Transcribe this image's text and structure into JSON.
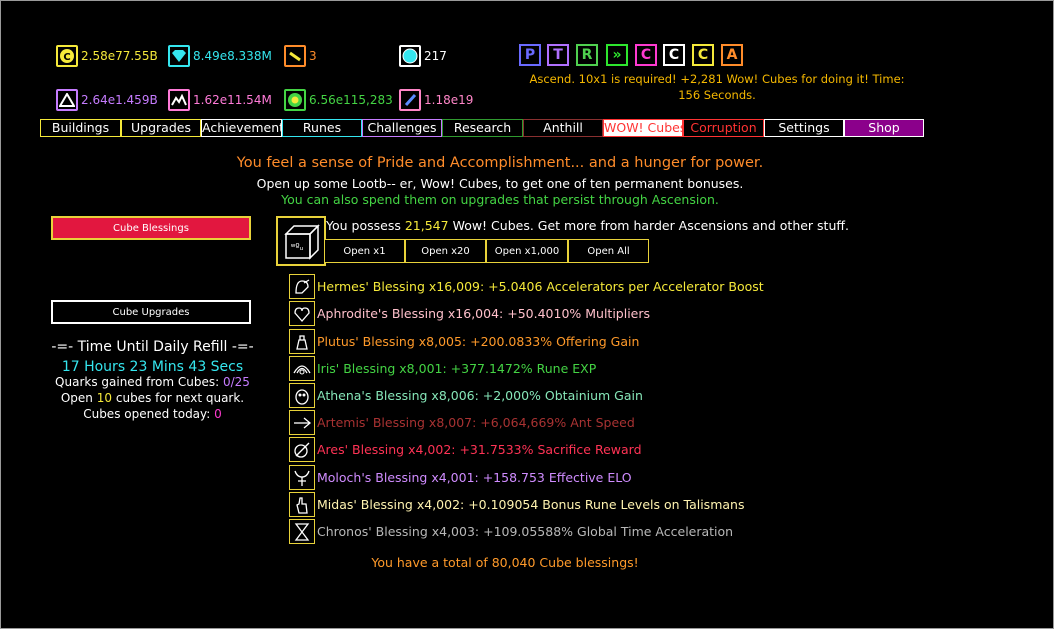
{
  "resources": {
    "coins": {
      "value": "2.58e77.55B",
      "color": "#f5e93a",
      "icon": "coin-icon"
    },
    "diamonds": {
      "value": "8.49e8.338M",
      "color": "#35e6ef",
      "icon": "diamond-icon"
    },
    "mythos": {
      "value": "3",
      "color": "#ff8c2a",
      "icon": "mythos-icon"
    },
    "particles": {
      "value": "217",
      "color": "#ffffff",
      "icon": "particle-icon"
    },
    "offerings": {
      "value": "2.64e1.459B",
      "color": "#c67cff",
      "icon": "offering-icon"
    },
    "obtainium": {
      "value": "1.62e11.54M",
      "color": "#ff7bd8",
      "icon": "obtainium-icon"
    },
    "quarks": {
      "value": "6.56e115,283",
      "color": "#44d444",
      "icon": "quark-icon"
    },
    "ascension": {
      "value": "1.18e19",
      "color": "#ff86c8",
      "icon": "ascension-icon"
    }
  },
  "letter_boxes": [
    {
      "letter": "P",
      "color": "#6a6aff"
    },
    {
      "letter": "T",
      "color": "#b070ff"
    },
    {
      "letter": "R",
      "color": "#4fd04f"
    },
    {
      "letter": "»",
      "color": "#2ee62e"
    },
    {
      "letter": "C",
      "color": "#ff3ad0"
    },
    {
      "letter": "C",
      "color": "#ffffff"
    },
    {
      "letter": "C",
      "color": "#f5e93a"
    },
    {
      "letter": "A",
      "color": "#ff8c2a"
    }
  ],
  "ascend_message": "Ascend. 10x1 is required! +2,281 Wow! Cubes for doing it! Time: 156 Seconds.",
  "tabs": [
    {
      "label": "Buildings",
      "border": "#f5e93a",
      "color": "#ffffff",
      "bg": "#000000"
    },
    {
      "label": "Upgrades",
      "border": "#f5e93a",
      "color": "#ffffff",
      "bg": "#000000"
    },
    {
      "label": "Achievements",
      "border": "#ffffff",
      "color": "#ffffff",
      "bg": "#000000"
    },
    {
      "label": "Runes",
      "border": "#35e6ef",
      "color": "#ffffff",
      "bg": "#000000"
    },
    {
      "label": "Challenges",
      "border": "#c67cff",
      "color": "#ffffff",
      "bg": "#000000"
    },
    {
      "label": "Research",
      "border": "#2f9a2f",
      "color": "#ffffff",
      "bg": "#000000"
    },
    {
      "label": "Anthill",
      "border": "#8a3030",
      "color": "#ffffff",
      "bg": "#000000"
    },
    {
      "label": "WOW! Cubes",
      "border": "#ff3333",
      "color": "#ff3333",
      "bg": "#ffffff"
    },
    {
      "label": "Corruption",
      "border": "#ff3333",
      "color": "#ff3333",
      "bg": "#000000"
    },
    {
      "label": "Settings",
      "border": "#ffffff",
      "color": "#ffffff",
      "bg": "#000000"
    },
    {
      "label": "Shop",
      "border": "#ffffff",
      "color": "#ffffff",
      "bg": "#8b008b"
    }
  ],
  "headline": "You feel a sense of Pride and Accomplishment... and a hunger for power.",
  "subline": "Open up some Lootb-- er, Wow! Cubes, to get one of ten permanent bonuses.",
  "subline2": "You can also spend them on upgrades that persist through Ascension.",
  "side_buttons": {
    "blessings": "Cube Blessings",
    "upgrades": "Cube Upgrades"
  },
  "refill": {
    "title": "-=- Time Until Daily Refill -=-",
    "time": "17 Hours 23 Mins 43 Secs",
    "quarks_prefix": "Quarks gained from Cubes:",
    "quarks_value": "0/25",
    "open_prefix": "Open",
    "open_value": "10",
    "open_suffix": "cubes for next quark.",
    "opened_prefix": "Cubes opened today:",
    "opened_value": "0"
  },
  "possess": {
    "prefix": "You possess",
    "amount": "21,547",
    "suffix": "Wow! Cubes. Get more from harder Ascensions and other stuff."
  },
  "open_buttons": [
    "Open x1",
    "Open x20",
    "Open x1,000",
    "Open All"
  ],
  "blessings": [
    {
      "text": "Hermes' Blessing x16,009: +5.0406 Accelerators per Accelerator Boost",
      "color": "#f5e93a",
      "icon": "hermes-icon"
    },
    {
      "text": "Aphrodite's Blessing x16,004: +50.4010% Multipliers",
      "color": "#ffc0cb",
      "icon": "aphrodite-icon"
    },
    {
      "text": "Plutus' Blessing x8,005: +200.0833% Offering Gain",
      "color": "#ff9a2a",
      "icon": "plutus-icon"
    },
    {
      "text": "Iris' Blessing x8,001: +377.1472% Rune EXP",
      "color": "#44d444",
      "icon": "iris-icon"
    },
    {
      "text": "Athena's Blessing x8,006: +2,000% Obtainium Gain",
      "color": "#86e6b8",
      "icon": "athena-icon"
    },
    {
      "text": "Artemis' Blessing x8,007: +6,064,669% Ant Speed",
      "color": "#a83232",
      "icon": "artemis-icon"
    },
    {
      "text": "Ares' Blessing x4,002: +31.7533% Sacrifice Reward",
      "color": "#ff3355",
      "icon": "ares-icon"
    },
    {
      "text": "Moloch's Blessing x4,001: +158.753 Effective ELO",
      "color": "#d08cff",
      "icon": "moloch-icon"
    },
    {
      "text": "Midas' Blessing x4,002: +0.109054 Bonus Rune Levels on Talismans",
      "color": "#fff3b0",
      "icon": "midas-icon"
    },
    {
      "text": "Chronos' Blessing x4,003: +109.05588% Global Time Acceleration",
      "color": "#b8b8b8",
      "icon": "chronos-icon"
    }
  ],
  "total": "You have a total of 80,040 Cube blessings!"
}
